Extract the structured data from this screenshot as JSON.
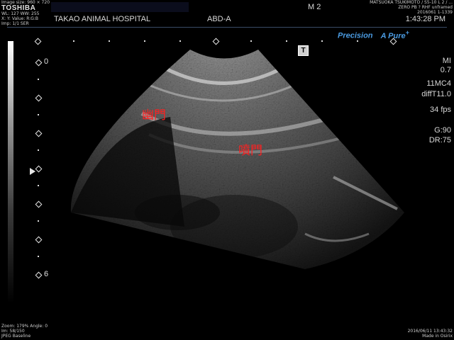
{
  "header": {
    "image_size": "Image size: 960 × 720",
    "brand": "TOSHIBA",
    "wl_ww": "WL: 127  WW: 255",
    "xy_value": "X: Y: Value: R:G:B",
    "frame_info": "Imp: 1/1 SER",
    "hospital": "TAKAO ANIMAL HOSPITAL",
    "preset": "ABD-A",
    "mode": "M 2",
    "operator": "MATSUOKA TSUKIMOTO / S5-10  L 2 / ...",
    "status": "ZERO PB ? RHF unframed",
    "study_id": "2016061 1-1339",
    "time": "1:43:28 PM"
  },
  "logo": {
    "precision": "Precision",
    "apure": "A Pure",
    "plus": "+",
    "t_marker": "T"
  },
  "params": {
    "mi_label": "MI",
    "mi_value": "0.7",
    "probe": "11MC4",
    "filter": "diffT11.0",
    "fps": "34 fps",
    "gain": "G:90",
    "dr": "DR:75"
  },
  "depth": {
    "top": "0",
    "bottom": "6"
  },
  "annotations": {
    "pylorus": "幽門",
    "cardia": "噴門"
  },
  "footer": {
    "zoom": "Zoom: 179%  Angle: 0",
    "frames": "Im: 58/150",
    "compression": "JPEG Baseline",
    "datetime": "2016/06/11 13:43:32",
    "origin": "Made in Osirix"
  },
  "colors": {
    "accent": "#3b8fd6",
    "annotation": "#ff2020",
    "header_line": "#3a4a66"
  }
}
